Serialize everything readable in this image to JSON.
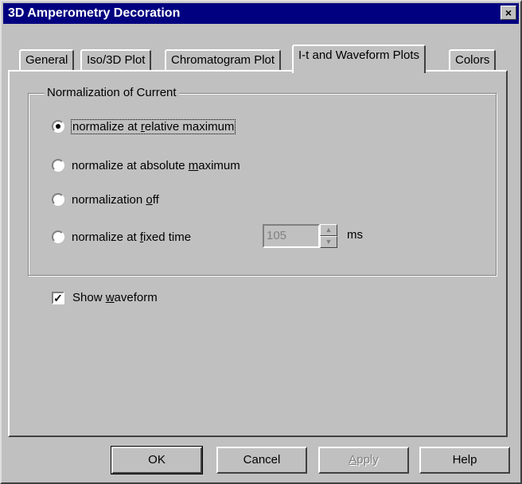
{
  "window": {
    "title": "3D Amperometry Decoration",
    "close_glyph": "×"
  },
  "tabs": [
    {
      "label": "General"
    },
    {
      "label": "Iso/3D Plot"
    },
    {
      "label": "Chromatogram Plot"
    },
    {
      "label": "I-t and Waveform Plots"
    },
    {
      "label": "Colors"
    }
  ],
  "active_tab": "I-t and Waveform Plots",
  "normalization": {
    "group_title": "Normalization of Current",
    "options": [
      {
        "label": "normalize at relative maximum",
        "checked": true
      },
      {
        "label": "normalize at absolute maximum",
        "checked": false
      },
      {
        "label": "normalization off",
        "checked": false
      },
      {
        "label": "normalize at fixed time",
        "checked": false
      }
    ],
    "fixed_time_value": "105",
    "fixed_time_unit": "ms"
  },
  "show_waveform": {
    "label": "Show waveform",
    "checked": true
  },
  "buttons": {
    "ok": "OK",
    "cancel": "Cancel",
    "apply": "Apply",
    "help": "Help"
  }
}
